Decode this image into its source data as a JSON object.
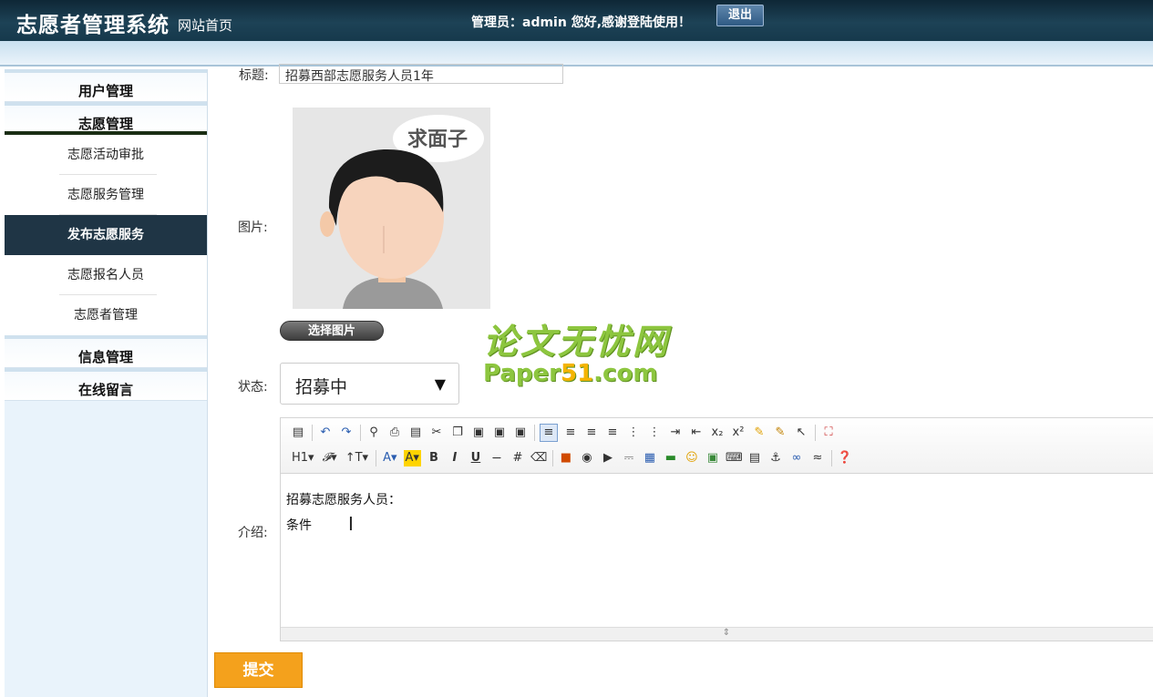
{
  "header": {
    "system_title": "志愿者管理系统",
    "home_link": "网站首页",
    "admin_text": "管理员：admin 您好,感谢登陆使用！",
    "logout": "退出"
  },
  "sidebar": {
    "menus": [
      {
        "label": "用户管理"
      },
      {
        "label": "志愿管理",
        "items": [
          "志愿活动审批",
          "志愿服务管理",
          "发布志愿服务",
          "志愿报名人员",
          "志愿者管理"
        ],
        "active": "发布志愿服务"
      },
      {
        "label": "信息管理"
      },
      {
        "label": "在线留言"
      }
    ]
  },
  "form": {
    "title_label": "标题:",
    "title_value": "招募西部志愿服务人员1年",
    "image_label": "图片:",
    "image_bubble": "求面子",
    "choose_image": "选择图片",
    "status_label": "状态:",
    "status_value": "招募中",
    "intro_label": "介绍:",
    "intro_lines": [
      "招募志愿服务人员：",
      "条件"
    ],
    "submit": "提交"
  },
  "toolbar": {
    "row2_text": [
      "H1",
      "A",
      "A",
      "B",
      "I",
      "U"
    ]
  },
  "watermark": {
    "cn": "论文无忧网",
    "en_a": "Paper",
    "en_b": "51",
    "en_c": ".com"
  },
  "colors": {
    "header_bg": "#1d4256",
    "active_menu_bg": "#1f3545",
    "submit_bg": "#f4a11c",
    "watermark_green": "#8dc63f"
  }
}
